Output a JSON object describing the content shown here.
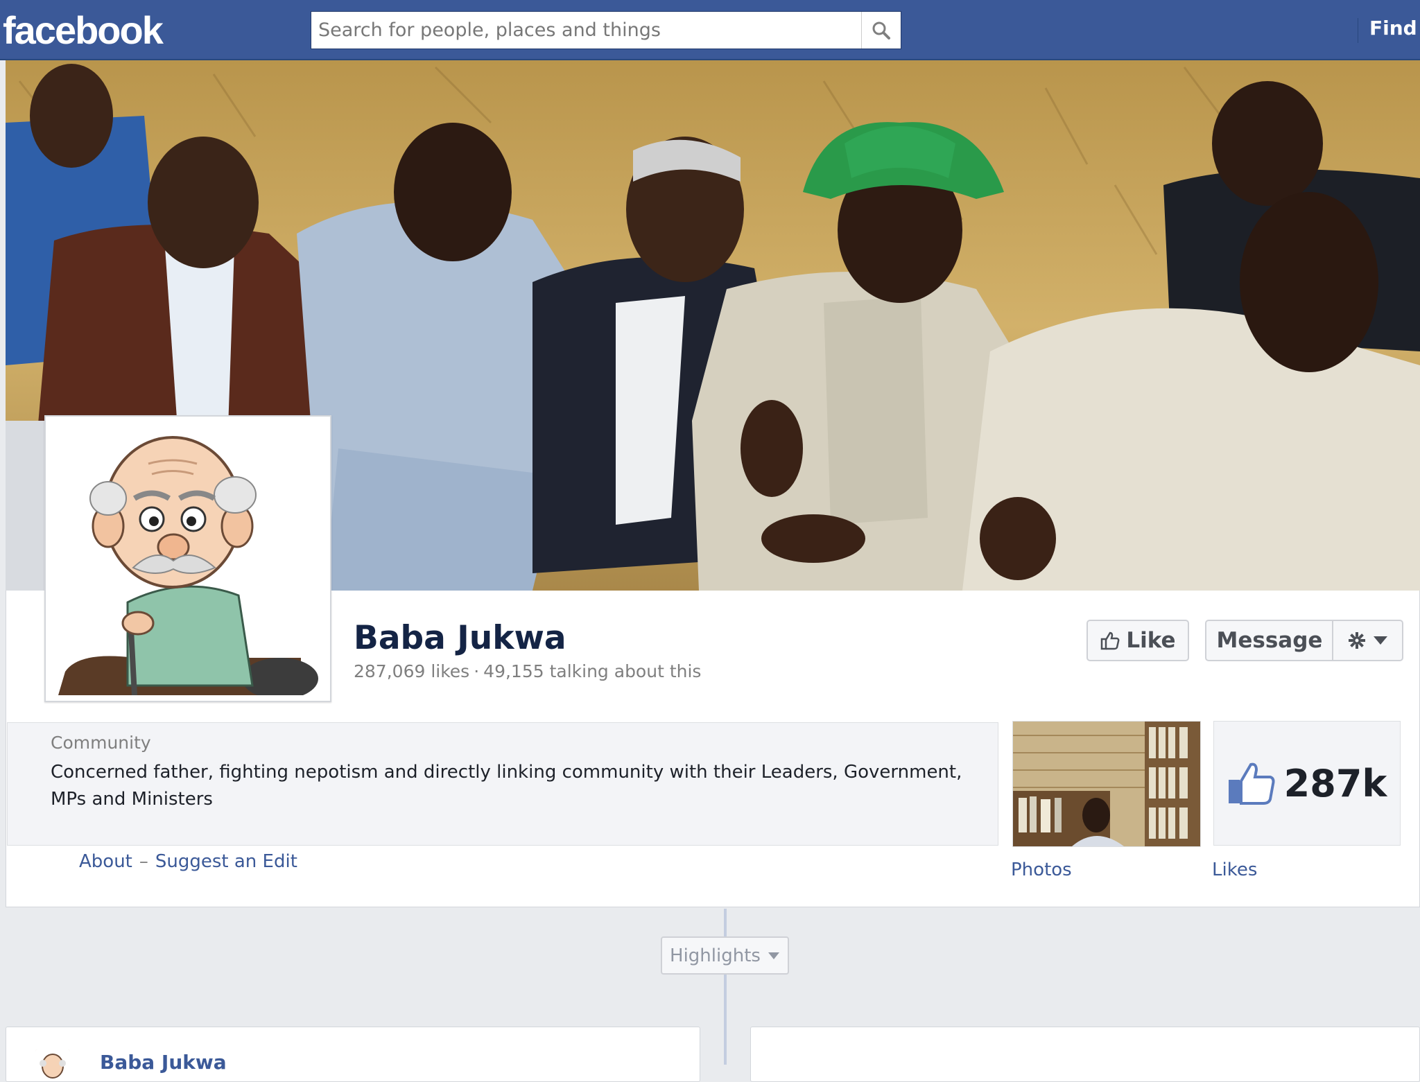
{
  "topbar": {
    "logo": "facebook",
    "search_placeholder": "Search for people, places and things",
    "find_link": "Find F",
    "search_icon": "search-icon"
  },
  "page": {
    "name": "Baba Jukwa",
    "likes": "287,069 likes",
    "talking": "49,155 talking about this",
    "category": "Community",
    "description": "Concerned father, fighting nepotism and directly linking community with their Leaders, Government, MPs and Ministers",
    "about_link": "About",
    "about_separator": "–",
    "suggest_link": "Suggest an Edit"
  },
  "actions": {
    "like_label": "Like",
    "message_label": "Message",
    "like_icon": "thumbs-up-icon",
    "gear_icon": "gear-icon",
    "dropdown_icon": "caret-down-icon"
  },
  "tiles": {
    "photos_label": "Photos",
    "likes_label": "Likes",
    "likes_count": "287k"
  },
  "timeline": {
    "highlights_label": "Highlights",
    "post_author": "Baba Jukwa"
  },
  "colors": {
    "brand_blue": "#3b5998",
    "topbar_border": "#29487d",
    "page_background": "#e9ebee"
  }
}
